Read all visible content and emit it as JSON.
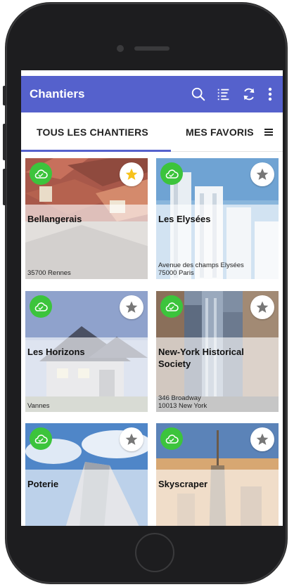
{
  "app_bar": {
    "title": "Chantiers",
    "background": "#5561cc",
    "actions": [
      "search-icon",
      "filter-list-icon",
      "sync-icon",
      "more-vert-icon"
    ]
  },
  "tabs": [
    {
      "label": "TOUS LES CHANTIERS",
      "active": true
    },
    {
      "label": "MES FAVORIS",
      "active": false
    }
  ],
  "tab_menu_icon": "menu-icon",
  "colors": {
    "accent": "#5561cc",
    "cloud_green": "#3cc43c",
    "favorite_yellow": "#f7c21b",
    "star_grey": "#777777"
  },
  "cards": [
    {
      "title": "Bellangerais",
      "address": "35700 Rennes",
      "favorite": true
    },
    {
      "title": "Les Elysées",
      "address": "Avenue des champs Elysées\n75000 Paris",
      "favorite": false
    },
    {
      "title": "Les Horizons",
      "address": "Vannes",
      "favorite": false
    },
    {
      "title": "New-York Historical Society",
      "address": "346 Broadway\n10013 New York",
      "favorite": false
    },
    {
      "title": "Poterie",
      "address": "",
      "favorite": false
    },
    {
      "title": "Skyscraper",
      "address": "",
      "favorite": false
    }
  ]
}
